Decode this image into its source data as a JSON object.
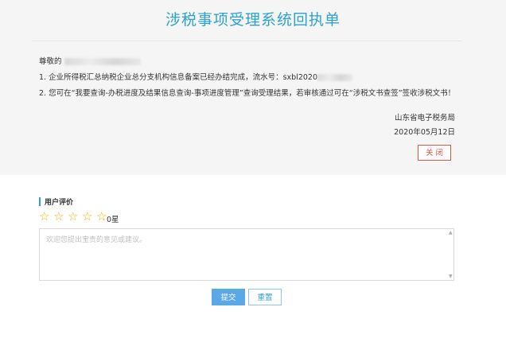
{
  "receipt": {
    "title": "涉税事项受理系统回执单",
    "greeting_prefix": "尊敬的",
    "line1": "1. 企业所得税汇总纳税企业总分支机构信息备案已经办结完成，流水号：sxbl2020",
    "line2": "2. 您可在“我要查询-办税进度及结果信息查询-事项进度管理”查询受理结果，若审核通过可在“涉税文书查签”签收涉税文书！",
    "issuer": "山东省电子税务局",
    "date": "2020年05月12日",
    "close_label": "关 闭"
  },
  "evaluation": {
    "section_title": "用户评价",
    "stars": [
      "☆",
      "☆",
      "☆",
      "☆",
      "☆"
    ],
    "rating_text": "0星",
    "comment_placeholder": "欢迎您提出宝贵的意见或建议。",
    "submit_label": "提交",
    "reset_label": "重置"
  },
  "colors": {
    "accent": "#2aa3cf",
    "danger": "#e0534a",
    "star": "#f0b400"
  }
}
